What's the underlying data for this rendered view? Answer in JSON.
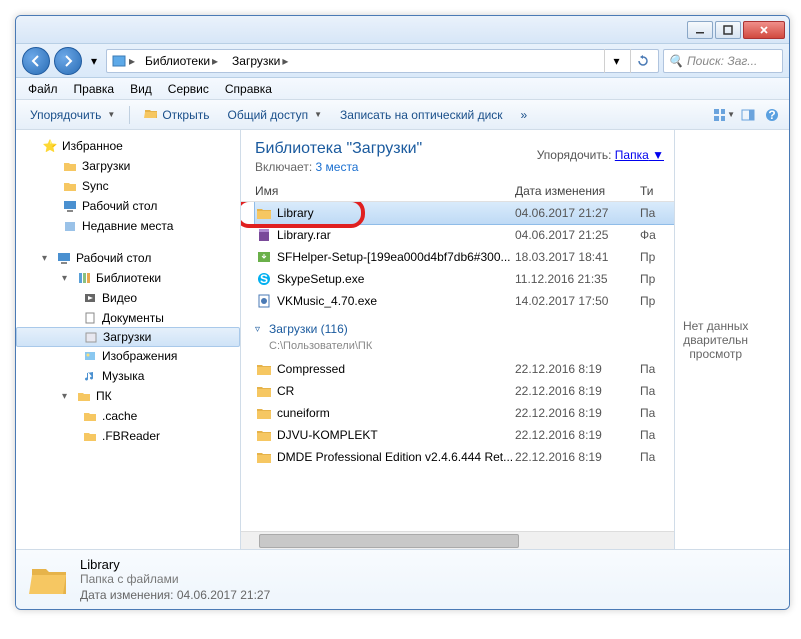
{
  "titlebar": {
    "min": "–",
    "max": "□",
    "close": "✕"
  },
  "breadcrumb": {
    "root": "Библиотеки",
    "current": "Загрузки"
  },
  "search": {
    "placeholder": "Поиск: Заг..."
  },
  "menu": {
    "file": "Файл",
    "edit": "Правка",
    "view": "Вид",
    "tools": "Сервис",
    "help": "Справка"
  },
  "toolbar": {
    "organize": "Упорядочить",
    "open": "Открыть",
    "share": "Общий доступ",
    "burn": "Записать на оптический диск",
    "more": "»"
  },
  "tree": {
    "favorites": "Избранное",
    "downloads": "Загрузки",
    "sync": "Sync",
    "desktop": "Рабочий стол",
    "recent": "Недавние места",
    "desktop2": "Рабочий стол",
    "libraries": "Библиотеки",
    "videos": "Видео",
    "documents": "Документы",
    "downloads2": "Загрузки",
    "pictures": "Изображения",
    "music": "Музыка",
    "pc": "ПК",
    "cache": ".cache",
    "fbreader": ".FBReader"
  },
  "library": {
    "title": "Библиотека \"Загрузки\"",
    "includes_label": "Включает:",
    "includes_link": "3 места",
    "arrange_label": "Упорядочить:",
    "arrange_value": "Папка"
  },
  "columns": {
    "name": "Имя",
    "date": "Дата изменения",
    "type": "Ти"
  },
  "files": [
    {
      "icon": "folder",
      "name": "Library",
      "date": "04.06.2017 21:27",
      "type": "Па",
      "selected": true
    },
    {
      "icon": "rar",
      "name": "Library.rar",
      "date": "04.06.2017 21:25",
      "type": "Фа"
    },
    {
      "icon": "exe-green",
      "name": "SFHelper-Setup-[199ea000d4bf7db6#300...",
      "date": "18.03.2017 18:41",
      "type": "Пр"
    },
    {
      "icon": "skype",
      "name": "SkypeSetup.exe",
      "date": "11.12.2016 21:35",
      "type": "Пр"
    },
    {
      "icon": "exe-blue",
      "name": "VKMusic_4.70.exe",
      "date": "14.02.2017 17:50",
      "type": "Пр"
    }
  ],
  "group": {
    "title": "Загрузки (116)",
    "path": "C:\\Пользователи\\ПК"
  },
  "files2": [
    {
      "icon": "folder",
      "name": "Compressed",
      "date": "22.12.2016 8:19",
      "type": "Па"
    },
    {
      "icon": "folder",
      "name": "CR",
      "date": "22.12.2016 8:19",
      "type": "Па"
    },
    {
      "icon": "folder",
      "name": "cuneiform",
      "date": "22.12.2016 8:19",
      "type": "Па"
    },
    {
      "icon": "folder",
      "name": "DJVU-KOMPLEKT",
      "date": "22.12.2016 8:19",
      "type": "Па"
    },
    {
      "icon": "folder",
      "name": "DMDE Professional Edition v2.4.6.444 Ret...",
      "date": "22.12.2016 8:19",
      "type": "Па"
    }
  ],
  "preview": {
    "text": "Нет данных\nдварительн\nпросмотр"
  },
  "details": {
    "name": "Library",
    "kind": "Папка с файлами",
    "mod_label": "Дата изменения:",
    "mod_value": "04.06.2017 21:27"
  }
}
